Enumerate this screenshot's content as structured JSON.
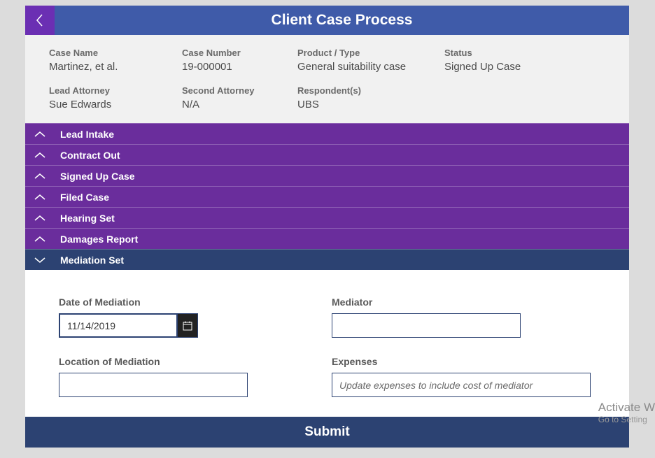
{
  "header": {
    "title": "Client Case Process"
  },
  "summary": {
    "case_name": {
      "label": "Case Name",
      "value": "Martinez, et al."
    },
    "case_number": {
      "label": "Case Number",
      "value": "19-000001"
    },
    "product_type": {
      "label": "Product / Type",
      "value": "General suitability case"
    },
    "status": {
      "label": "Status",
      "value": "Signed Up Case"
    },
    "lead_attorney": {
      "label": "Lead Attorney",
      "value": "Sue Edwards"
    },
    "second_attorney": {
      "label": "Second Attorney",
      "value": "N/A"
    },
    "respondents": {
      "label": "Respondent(s)",
      "value": "UBS"
    }
  },
  "accordion": {
    "items": [
      {
        "label": "Lead Intake"
      },
      {
        "label": "Contract Out"
      },
      {
        "label": "Signed Up Case"
      },
      {
        "label": "Filed Case"
      },
      {
        "label": "Hearing Set"
      },
      {
        "label": "Damages Report"
      },
      {
        "label": "Mediation Set"
      }
    ]
  },
  "form": {
    "date_of_mediation": {
      "label": "Date of Mediation",
      "value": "11/14/2019"
    },
    "mediator": {
      "label": "Mediator",
      "value": ""
    },
    "location_of_mediation": {
      "label": "Location of Mediation",
      "value": ""
    },
    "expenses": {
      "label": "Expenses",
      "placeholder": "Update expenses to include cost of mediator",
      "value": ""
    }
  },
  "submit": {
    "label": "Submit"
  },
  "watermark": {
    "line1": "Activate W",
    "line2": "Go to Setting"
  }
}
